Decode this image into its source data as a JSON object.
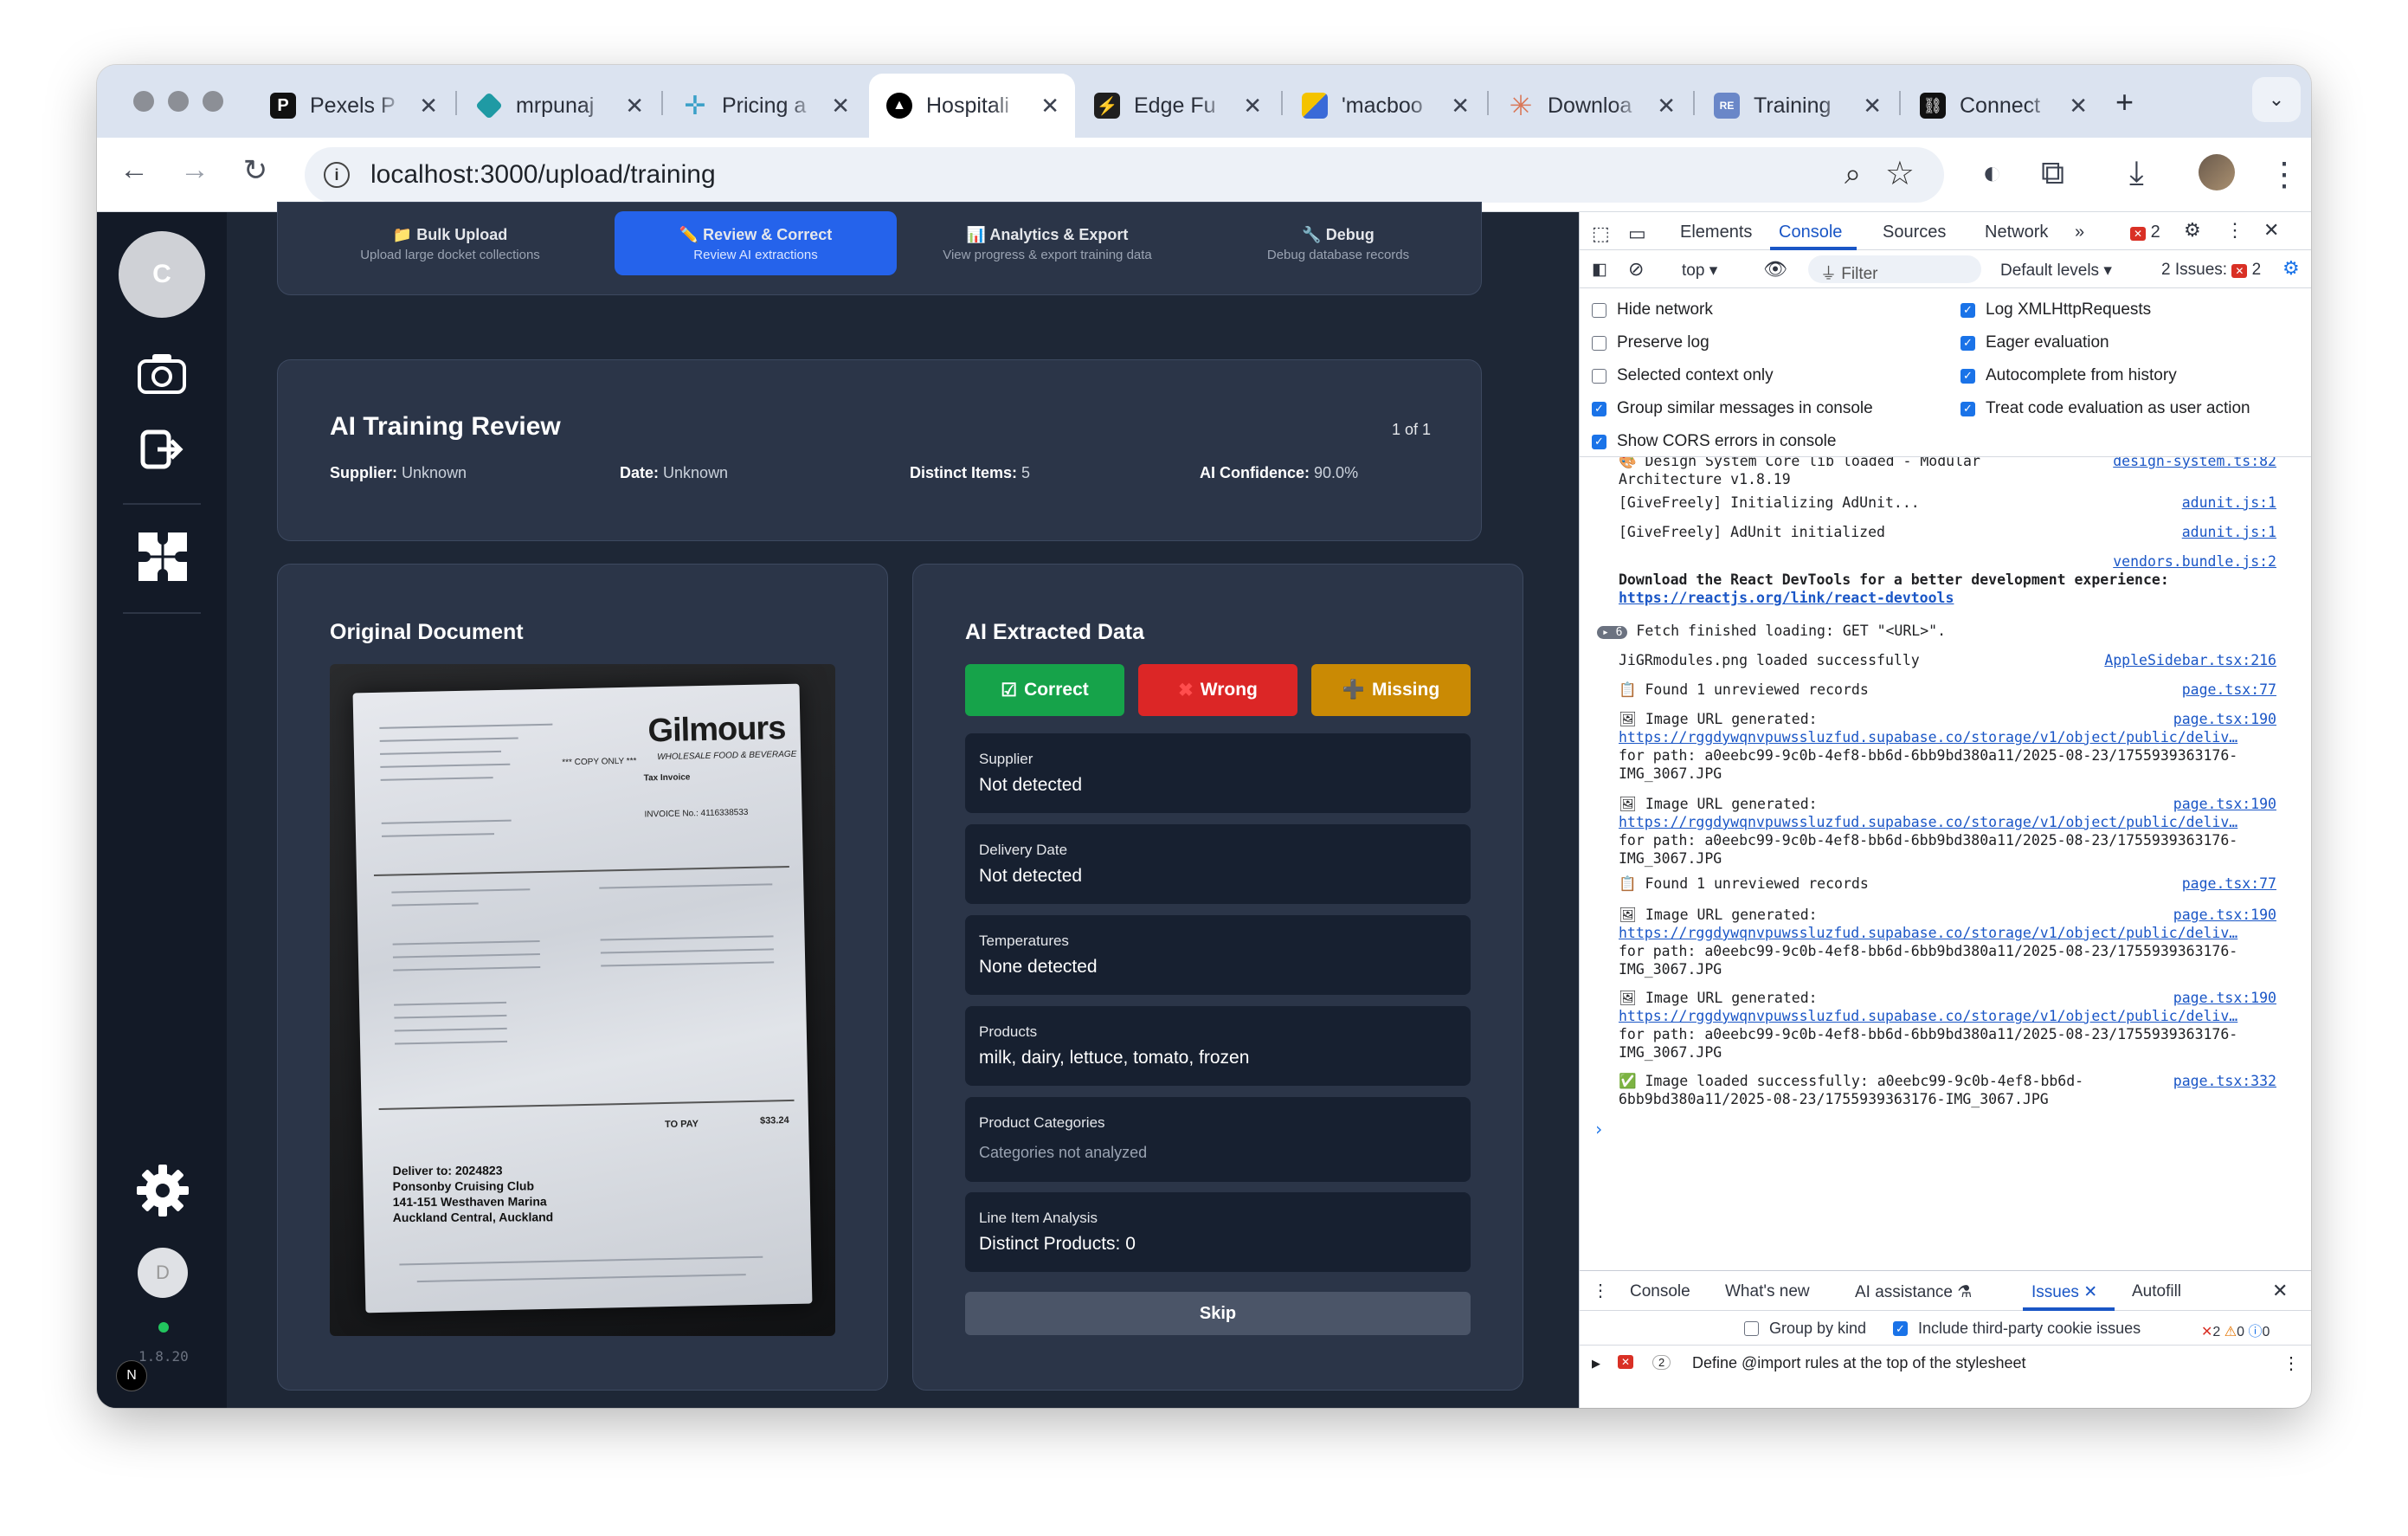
{
  "browser": {
    "tabs": [
      {
        "label": "Pexels P",
        "icon": "pexels-icon",
        "color": "#1a1a1a"
      },
      {
        "label": "mrpunaj",
        "icon": "diamond-icon",
        "color": "#1f9aa4"
      },
      {
        "label": "Pricing a",
        "icon": "sparkle-icon",
        "color": "#3aa0c8"
      },
      {
        "label": "Hospitali",
        "icon": "vercel-triangle-icon",
        "color": "#000000"
      },
      {
        "label": "Edge Fu",
        "icon": "supabase-icon",
        "color": "#1f1f1f"
      },
      {
        "label": "'macboo",
        "icon": "search-favicon-icon",
        "color": "#f4c300"
      },
      {
        "label": "Downloa",
        "icon": "claude-icon",
        "color": "#d97757"
      },
      {
        "label": "Training",
        "icon": "ref-icon",
        "color": "#6a87c8"
      },
      {
        "label": "Connect",
        "icon": "link-icon",
        "color": "#111111"
      }
    ],
    "active_tab_index": 3,
    "url": "localhost:3000/upload/training"
  },
  "sidebar": {
    "avatar_letter": "C",
    "user_letter": "D",
    "version": "1.8.20",
    "next_badge": "N"
  },
  "nav": {
    "tabs": [
      {
        "title": "📁 Bulk Upload",
        "subtitle": "Upload large docket collections"
      },
      {
        "title": "✏️ Review & Correct",
        "subtitle": "Review AI extractions"
      },
      {
        "title": "📊 Analytics & Export",
        "subtitle": "View progress & export training data"
      },
      {
        "title": "🔧 Debug",
        "subtitle": "Debug database records"
      }
    ]
  },
  "review": {
    "title": "AI Training Review",
    "counter": "1 of 1",
    "supplier_label": "Supplier:",
    "supplier_value": "Unknown",
    "date_label": "Date:",
    "date_value": "Unknown",
    "items_label": "Distinct Items:",
    "items_value": "5",
    "confidence_label": "AI Confidence:",
    "confidence_value": "90.0%"
  },
  "document": {
    "title": "Original Document",
    "brand": "Gilmours",
    "tagline": "WHOLESALE FOOD & BEVERAGE",
    "copy_only": "*** COPY ONLY ***",
    "tax_invoice": "Tax Invoice",
    "invoice_no": "INVOICE No.: 4116338533",
    "to_pay": "TO PAY",
    "total": "$33.24",
    "deliver_to": "Deliver to: 2024823",
    "deliver_name": "Ponsonby Cruising Club",
    "deliver_addr1": "141-151 Westhaven Marina",
    "deliver_addr2": "Auckland Central, Auckland"
  },
  "extracted": {
    "title": "AI Extracted Data",
    "correct_label": "Correct",
    "wrong_label": "Wrong",
    "missing_label": "Missing",
    "fields": [
      {
        "label": "Supplier",
        "value": "Not detected"
      },
      {
        "label": "Delivery Date",
        "value": "Not detected"
      },
      {
        "label": "Temperatures",
        "value": "None detected"
      },
      {
        "label": "Products",
        "value": "milk, dairy, lettuce, tomato, frozen"
      },
      {
        "label": "Product Categories",
        "value": "Categories not analyzed"
      },
      {
        "label": "Line Item Analysis",
        "value": "Distinct Products: 0"
      }
    ],
    "skip_label": "Skip"
  },
  "devtools": {
    "tabs": [
      "Elements",
      "Console",
      "Sources",
      "Network"
    ],
    "error_count": "2",
    "context": "top",
    "filter_placeholder": "Filter",
    "levels": "Default levels",
    "issues_label": "2 Issues:",
    "issues_count": "2",
    "settings_left": [
      {
        "label": "Hide network",
        "checked": false
      },
      {
        "label": "Preserve log",
        "checked": false
      },
      {
        "label": "Selected context only",
        "checked": false
      },
      {
        "label": "Group similar messages in console",
        "checked": true
      },
      {
        "label": "Show CORS errors in console",
        "checked": true
      }
    ],
    "settings_right": [
      {
        "label": "Log XMLHttpRequests",
        "checked": true
      },
      {
        "label": "Eager evaluation",
        "checked": true
      },
      {
        "label": "Autocomplete from history",
        "checked": true
      },
      {
        "label": "Treat code evaluation as user action",
        "checked": true
      }
    ],
    "console": {
      "l0": "🎨 Design System Core lib loaded - Modular",
      "l0src": "design-system.ts:82",
      "l0b": "Architecture v1.8.19",
      "l1": "[GiveFreely] Initializing AdUnit...",
      "l1src": "adunit.js:1",
      "l2": "[GiveFreely] AdUnit initialized",
      "l2src": "adunit.js:1",
      "l3src": "vendors.bundle.js:2",
      "l3": "Download the React DevTools for a better development experience:",
      "l3link": "https://reactjs.org/link/react-devtools",
      "l4count": "6",
      "l4": "Fetch finished loading: GET \"<URL>\".",
      "l5": "JiGRmodules.png loaded successfully",
      "l5src": "AppleSidebar.tsx:216",
      "l6": "Found 1 unreviewed records",
      "l6src": "page.tsx:77",
      "img1": "Image URL generated:",
      "imgsrc": "page.tsx:190",
      "imglink": "https://rggdywqnvpuwssluzfud.supabase.co/storage/v1/object/public/deliv…",
      "imgpath": "for path: a0eebc99-9c0b-4ef8-bb6d-6bb9bd380a11/2025-08-23/1755939363176-",
      "imgfile": "IMG_3067.JPG",
      "l7": "Found 1 unreviewed records",
      "l7src": "page.tsx:77",
      "l8": "Image loaded successfully: a0eebc99-9c0b-4ef8-bb6d-",
      "l8b": "6bb9bd380a11/2025-08-23/1755939363176-IMG_3067.JPG",
      "l8src": "page.tsx:332"
    },
    "drawer_tabs": [
      "Console",
      "What's new",
      "AI assistance",
      "Issues",
      "Autofill"
    ],
    "group_by_kind": "Group by kind",
    "include_third_party": "Include third-party cookie issues",
    "issue_badges": [
      "2",
      "0",
      "0"
    ],
    "issue_count": "2",
    "issue_text": "Define @import rules at the top of the stylesheet"
  }
}
